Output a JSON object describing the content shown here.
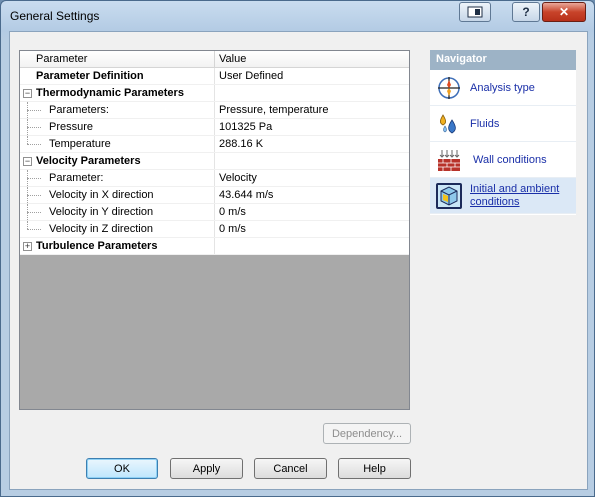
{
  "window": {
    "title": "General Settings"
  },
  "titlebar_buttons": {
    "help": "?",
    "close": "✕"
  },
  "grid": {
    "headers": {
      "parameter": "Parameter",
      "value": "Value"
    },
    "rows": [
      {
        "label": "Parameter Definition",
        "value": "User Defined"
      },
      {
        "label": "Thermodynamic Parameters",
        "value": ""
      },
      {
        "label": "Parameters:",
        "value": "Pressure, temperature"
      },
      {
        "label": "Pressure",
        "value": "101325 Pa"
      },
      {
        "label": "Temperature",
        "value": "288.16 K"
      },
      {
        "label": "Velocity Parameters",
        "value": ""
      },
      {
        "label": "Parameter:",
        "value": "Velocity"
      },
      {
        "label": "Velocity in X direction",
        "value": "43.644 m/s"
      },
      {
        "label": "Velocity in Y direction",
        "value": "0 m/s"
      },
      {
        "label": "Velocity in Z direction",
        "value": "0 m/s"
      },
      {
        "label": "Turbulence Parameters",
        "value": ""
      }
    ]
  },
  "navigator": {
    "title": "Navigator",
    "items": [
      {
        "label": "Analysis type"
      },
      {
        "label": "Fluids"
      },
      {
        "label": "Wall conditions"
      },
      {
        "label": "Initial and ambient conditions"
      }
    ]
  },
  "buttons": {
    "dependency": "Dependency...",
    "ok": "OK",
    "apply": "Apply",
    "cancel": "Cancel",
    "help": "Help"
  }
}
